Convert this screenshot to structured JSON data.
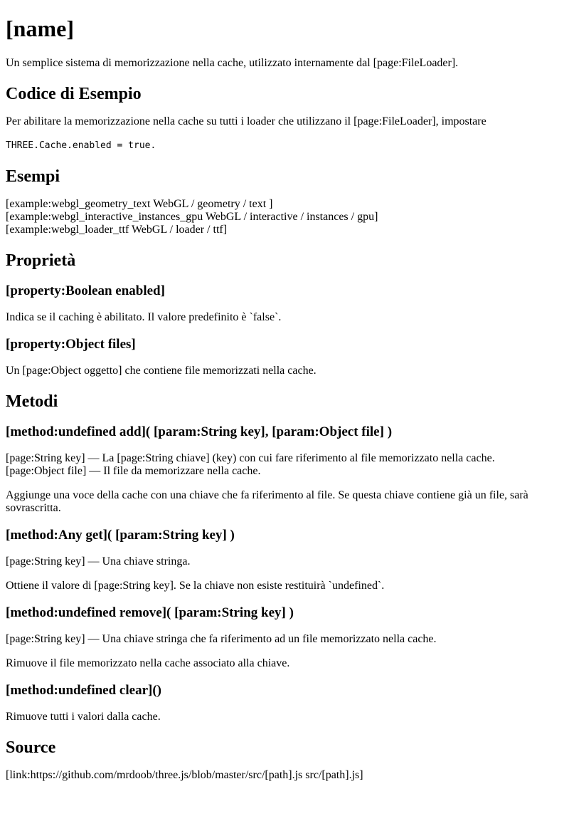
{
  "title": "[name]",
  "intro": "Un semplice sistema di memorizzazione nella cache, utilizzato internamente dal [page:FileLoader].",
  "code_section": {
    "heading": "Codice di Esempio",
    "text": "Per abilitare la memorizzazione nella cache su tutti i loader che utilizzano il [page:FileLoader], impostare",
    "code": "THREE.Cache.enabled = true."
  },
  "examples_section": {
    "heading": "Esempi",
    "items": [
      "[example:webgl_geometry_text WebGL / geometry / text ]",
      "[example:webgl_interactive_instances_gpu WebGL / interactive / instances / gpu]",
      "[example:webgl_loader_ttf WebGL / loader / ttf]"
    ]
  },
  "properties_section": {
    "heading": "Proprietà",
    "items": [
      {
        "name": "[property:Boolean enabled]",
        "description": "Indica se il caching è abilitato. Il valore predefinito è `false`."
      },
      {
        "name": "[property:Object files]",
        "description": "Un [page:Object oggetto] che contiene file memorizzati nella cache."
      }
    ]
  },
  "methods_section": {
    "heading": "Metodi",
    "add": {
      "signature": "[method:undefined add]( [param:String key], [param:Object file] )",
      "param1": "[page:String key] — La [page:String chiave] (key) con cui fare riferimento al file memorizzato nella cache.",
      "param2": "[page:Object file] — Il file da memorizzare nella cache.",
      "description": "Aggiunge una voce della cache con una chiave che fa riferimento al file. Se questa chiave contiene già un file, sarà sovrascritta."
    },
    "get": {
      "signature": "[method:Any get]( [param:String key] )",
      "param1": "[page:String key] — Una chiave stringa.",
      "description": "Ottiene il valore di [page:String key]. Se la chiave non esiste restituirà `undefined`."
    },
    "remove": {
      "signature": "[method:undefined remove]( [param:String key] )",
      "param1": "[page:String key] — Una chiave stringa che fa riferimento ad un file memorizzato nella cache.",
      "description": "Rimuove il file memorizzato nella cache associato alla chiave."
    },
    "clear": {
      "signature": "[method:undefined clear]()",
      "description": "Rimuove tutti i valori dalla cache."
    }
  },
  "source_section": {
    "heading": "Source",
    "link": "[link:https://github.com/mrdoob/three.js/blob/master/src/[path].js src/[path].js]"
  }
}
